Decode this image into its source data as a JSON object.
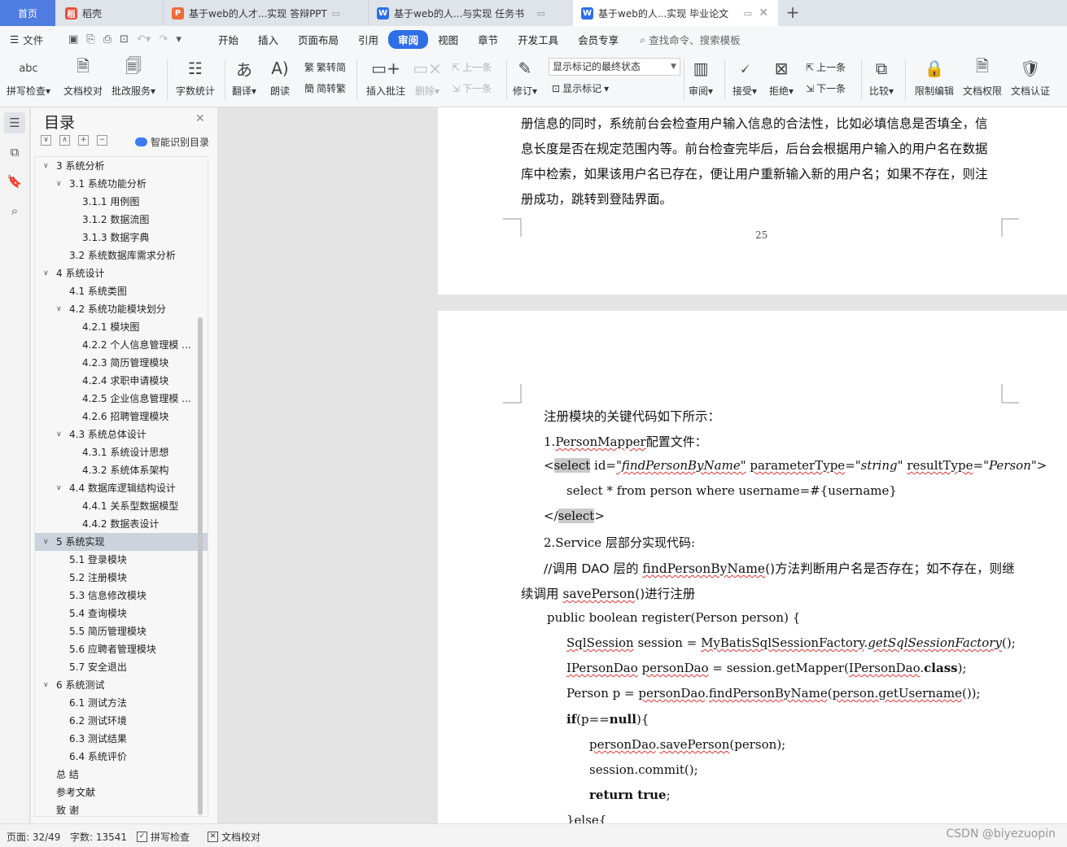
{
  "tabs": {
    "home": "首页",
    "t1": "稻壳",
    "t2": "基于web的人才...实现 答辩PPT",
    "t3": "基于web的人...与实现 任务书",
    "t4": "基于web的人...实现 毕业论文",
    "new": "+"
  },
  "menu": {
    "file": "文件",
    "items": [
      "开始",
      "插入",
      "页面布局",
      "引用",
      "审阅",
      "视图",
      "章节",
      "开发工具",
      "会员专享"
    ],
    "active": "审阅",
    "search": "查找命令、搜索模板"
  },
  "ribbon": {
    "spell": "拼写检查",
    "proof": "文档校对",
    "batch": "批改服务",
    "wordcount": "字数统计",
    "translate": "翻译",
    "read": "朗读",
    "trad": "繁转简",
    "simp": "简转繁",
    "insert_comment": "插入批注",
    "delete": "删除",
    "prev_comment": "上一条",
    "next_comment": "下一条",
    "revise": "修订",
    "show_state": "显示标记的最终状态",
    "show_marks": "显示标记",
    "review": "审阅",
    "accept": "接受",
    "reject": "拒绝",
    "prev": "上一条",
    "next": "下一条",
    "compare": "比较",
    "restrict": "限制编辑",
    "permission": "文档权限",
    "certify": "文档认证"
  },
  "toc": {
    "title": "目录",
    "smart": "智能识别目录",
    "items": [
      {
        "text": "3  系统分析",
        "level": 1,
        "arrow": "open"
      },
      {
        "text": "3.1 系统功能分析",
        "level": 2,
        "arrow": "open"
      },
      {
        "text": "3.1.1  用例图",
        "level": 3
      },
      {
        "text": "3.1.2  数据流图",
        "level": 3
      },
      {
        "text": "3.1.3  数据字典",
        "level": 3
      },
      {
        "text": "3.2  系统数据库需求分析",
        "level": 2
      },
      {
        "text": "4  系统设计",
        "level": 1,
        "arrow": "open"
      },
      {
        "text": "4.1 系统类图",
        "level": 2
      },
      {
        "text": "4.2 系统功能模块划分",
        "level": 2,
        "arrow": "open"
      },
      {
        "text": "4.2.1  模块图",
        "level": 3
      },
      {
        "text": "4.2.2  个人信息管理模 ...",
        "level": 3
      },
      {
        "text": "4.2.3  简历管理模块",
        "level": 3
      },
      {
        "text": "4.2.4  求职申请模块",
        "level": 3
      },
      {
        "text": "4.2.5  企业信息管理模 ...",
        "level": 3
      },
      {
        "text": "4.2.6  招聘管理模块",
        "level": 3
      },
      {
        "text": "4.3 系统总体设计",
        "level": 2,
        "arrow": "open"
      },
      {
        "text": "4.3.1  系统设计思想",
        "level": 3
      },
      {
        "text": "4.3.2  系统体系架构",
        "level": 3
      },
      {
        "text": "4.4  数据库逻辑结构设计",
        "level": 2,
        "arrow": "open"
      },
      {
        "text": "4.4.1  关系型数据模型",
        "level": 3
      },
      {
        "text": "4.4.2  数据表设计",
        "level": 3
      },
      {
        "text": "5  系统实现",
        "level": 1,
        "arrow": "open",
        "selected": true
      },
      {
        "text": "5.1  登录模块",
        "level": 2
      },
      {
        "text": "5.2  注册模块",
        "level": 2
      },
      {
        "text": "5.3  信息修改模块",
        "level": 2
      },
      {
        "text": "5.4  查询模块",
        "level": 2
      },
      {
        "text": "5.5  简历管理模块",
        "level": 2
      },
      {
        "text": "5.6  应聘者管理模块",
        "level": 2
      },
      {
        "text": "5.7  安全退出",
        "level": 2
      },
      {
        "text": "6  系统测试",
        "level": 1,
        "arrow": "open"
      },
      {
        "text": "6.1  测试方法",
        "level": 2
      },
      {
        "text": "6.2 测试环境",
        "level": 2
      },
      {
        "text": "6.3 测试结果",
        "level": 2
      },
      {
        "text": "6.4 系统评价",
        "level": 2
      },
      {
        "text": "总    结",
        "level": 1
      },
      {
        "text": "参考文献",
        "level": 1
      },
      {
        "text": "致  谢",
        "level": 1
      }
    ]
  },
  "page1": {
    "lines": [
      "册信息的同时，系统前台会检查用户输入信息的合法性，比如必填信息是否填全，信",
      "息长度是否在规定范围内等。前台检查完毕后，后台会根据用户输入的用户名在数据",
      "库中检索，如果该用户名已存在，便让用户重新输入新的用户名；如果不存在，则注",
      "册成功，跳转到登陆界面。"
    ],
    "page_number": "25"
  },
  "page2": {
    "intro": "注册模块的关键代码如下所示：",
    "l1a": "1.",
    "l1b": "PersonMapper",
    "l1c": "配置文件：",
    "sel_tag": "select",
    "sel_id": " id=",
    "sel_idval": "\"findPersonByName\"",
    "sel_pt": "parameterType",
    "sel_ptval": "\"string\"",
    "sel_rt": "resultType",
    "sel_rtval": "\"Person\"",
    "sql": "select * from person where username=#{username}",
    "close_tag": "select",
    "service": " 2.Service 层部分实现代码:",
    "c1a": "//调用 DAO 层的 ",
    "c1b": "findPersonByName",
    "c1c": "()方法判断用户名是否存在；如不存在，则继",
    "c2a": "续调用 ",
    "c2b": "savePerson",
    "c2c": "()进行注册",
    "m1": "public boolean register(Person person) {",
    "s1a": "SqlSession",
    "s1b": " session = ",
    "s1c": "MyBatisSqlSessionFactory",
    "s1d": ".",
    "s1e": "getSqlSessionFactory",
    "s1f": "();",
    "d1a": "IPersonDao",
    "d1b": " ",
    "d1c": "personDao",
    "d1d": " = session.getMapper(",
    "d1e": "IPersonDao",
    "d1f": ".",
    "d1g": "class",
    "d1h": ");",
    "p1a": "Person p = ",
    "p1b": "personDao",
    "p1c": ".",
    "p1d": "findPersonByName",
    "p1e": "(",
    "p1f": "person.getUsername",
    "p1g": "());",
    "if1": "if",
    "if2": "(p==",
    "if3": "null",
    "if4": "){",
    "sv1": "personDao",
    "sv2": ".",
    "sv3": "savePerson",
    "sv4": "(person);",
    "commit": "session.commit();",
    "ret1": "return true",
    "ret2": ";",
    "else": "}else{"
  },
  "status": {
    "page": "页面: 32/49",
    "words": "字数: 13541",
    "spell": "拼写检查",
    "proof": "文档校对",
    "watermark": "CSDN @biyezuopin"
  },
  "colors": {
    "accent": "#2d6fe6",
    "home_tab": "#4f7ce0",
    "squiggle": "#d33333"
  }
}
